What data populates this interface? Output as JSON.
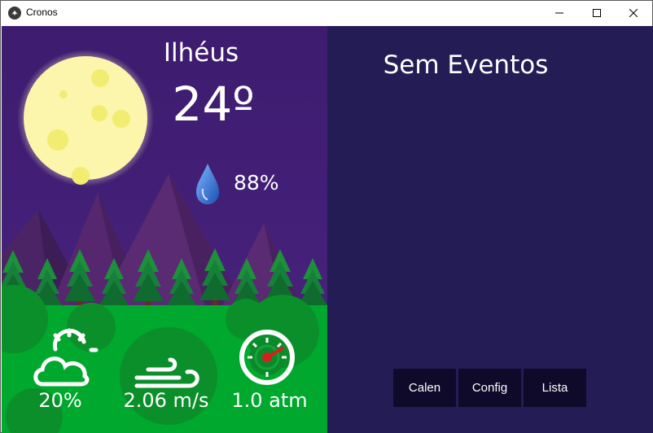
{
  "window": {
    "title": "Cronos",
    "app_icon": "kivy-logo-icon",
    "controls": [
      "minimize-icon",
      "maximize-icon",
      "close-icon"
    ]
  },
  "weather": {
    "city": "Ilhéus",
    "temperature": "24º",
    "humidity": "88%",
    "cloudiness": "20%",
    "wind_speed": "2.06 m/s",
    "pressure": "1.0 atm",
    "icons": [
      "moon-icon",
      "raindrop-icon",
      "partly-cloudy-icon",
      "wind-icon",
      "gauge-icon"
    ]
  },
  "events": {
    "status": "Sem Eventos"
  },
  "buttons": {
    "calendar": "Calen",
    "config": "Config",
    "list": "Lista"
  },
  "colors": {
    "sky": "#3b1d6b",
    "ground": "#00a82d",
    "panel": "#241c55",
    "button": "#0f0a2a",
    "moon": "#fbf6ab"
  }
}
